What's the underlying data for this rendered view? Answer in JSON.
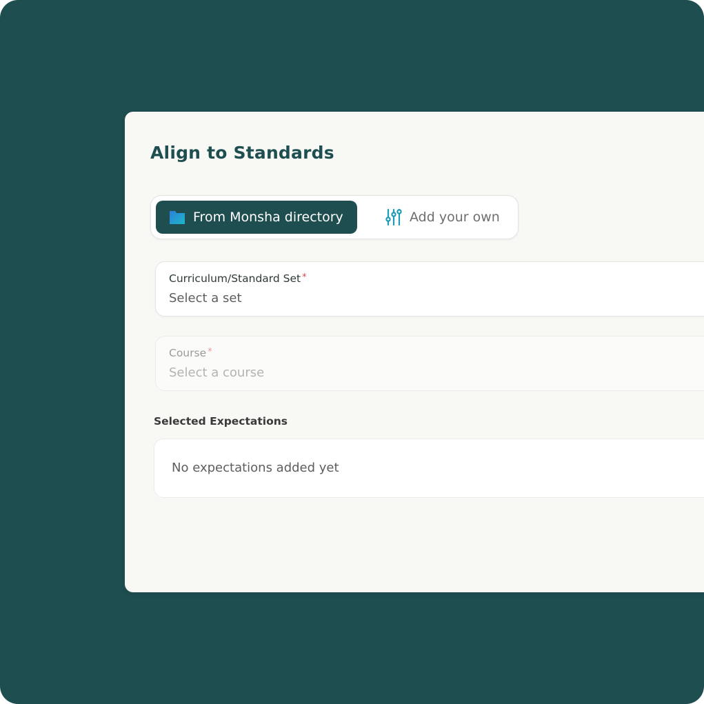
{
  "dialog": {
    "title": "Align to Standards"
  },
  "source_toggle": {
    "options": [
      {
        "label": "From Monsha directory",
        "icon": "folder-icon",
        "selected": true
      },
      {
        "label": "Add your own",
        "icon": "sliders-icon",
        "selected": false
      }
    ]
  },
  "fields": {
    "curriculum": {
      "label": "Curriculum/Standard Set",
      "required_mark": "*",
      "placeholder": "Select a set"
    },
    "course": {
      "label": "Course",
      "required_mark": "*",
      "placeholder": "Select a course",
      "disabled": true
    }
  },
  "expectations": {
    "heading": "Selected Expectations",
    "empty_text": "No expectations added yet"
  },
  "colors": {
    "background": "#1f4e50",
    "accent": "#1f4e50",
    "panel": "#f8f8f5",
    "required": "#d94a4a"
  }
}
